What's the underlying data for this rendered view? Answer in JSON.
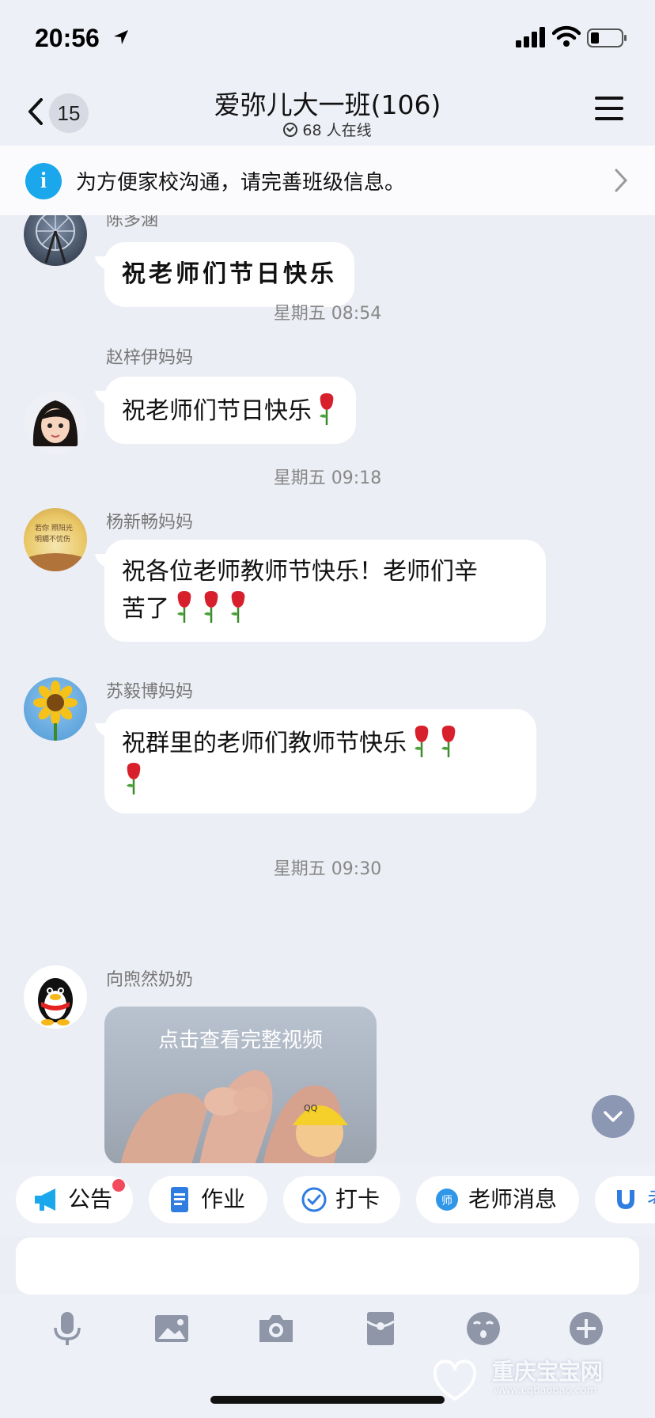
{
  "status_bar": {
    "time": "20:56"
  },
  "nav": {
    "back_count": "15",
    "title": "爱弥儿大一班(106)",
    "online": "68 人在线"
  },
  "notice": {
    "text": "为方便家校沟通，请完善班级信息。"
  },
  "messages": [
    {
      "sender": "陈多涵",
      "text": "祝老师们节日快乐"
    },
    {
      "timestamp": "星期五 08:54"
    },
    {
      "sender": "赵梓伊妈妈",
      "text": "祝老师们节日快乐"
    },
    {
      "timestamp": "星期五 09:18"
    },
    {
      "sender": "杨新畅妈妈",
      "text_line1": "祝各位老师教师节快乐！老师们辛",
      "text_line2": "苦了"
    },
    {
      "sender": "苏毅博妈妈",
      "text": "祝群里的老师们教师节快乐"
    },
    {
      "timestamp": "星期五 09:30"
    },
    {
      "sender": "向煦然奶奶",
      "video_label": "点击查看完整视频"
    }
  ],
  "quick_actions": [
    {
      "label": "公告",
      "icon": "megaphone-icon"
    },
    {
      "label": "作业",
      "icon": "document-icon"
    },
    {
      "label": "打卡",
      "icon": "check-icon"
    },
    {
      "label": "老师消息",
      "icon": "teacher-icon"
    },
    {
      "label": "考",
      "icon": "magnet-icon"
    }
  ],
  "toolbar": [
    "microphone-icon",
    "image-icon",
    "camera-icon",
    "red-packet-icon",
    "emoji-icon",
    "plus-icon"
  ],
  "watermark": {
    "title": "重庆宝宝网",
    "url": "www.cqbaobao.com"
  },
  "colors": {
    "accent": "#1aa7ec",
    "background": "#eceef5",
    "badge": "#f24b5c"
  }
}
